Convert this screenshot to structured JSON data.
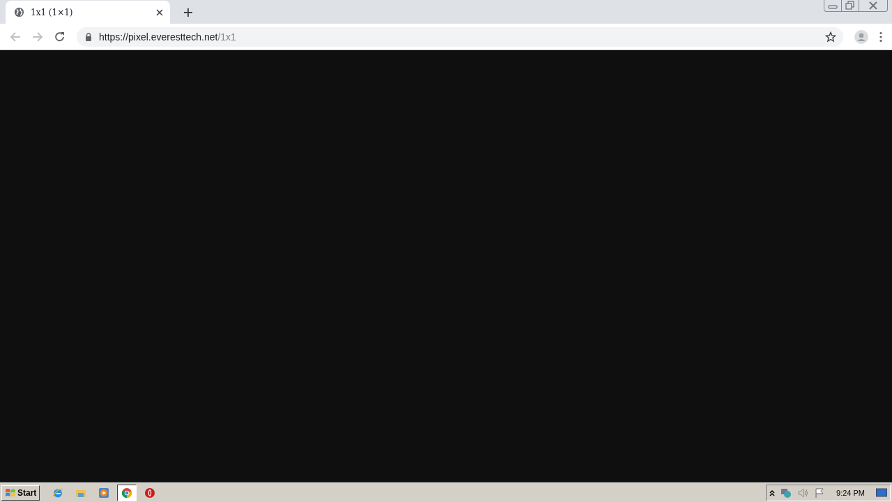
{
  "tabs": [
    {
      "title": "1x1 (1×1)",
      "selected": true
    }
  ],
  "address_bar": {
    "scheme_host": "https://pixel.everesttech.net",
    "path": "/1x1"
  },
  "toolbar": {
    "back_disabled": true,
    "forward_disabled": true
  },
  "taskbar": {
    "start_label": "Start",
    "apps": [
      {
        "kind": "ie",
        "selected": false
      },
      {
        "kind": "explorer",
        "selected": false
      },
      {
        "kind": "media",
        "selected": false
      },
      {
        "kind": "chrome",
        "selected": true
      },
      {
        "kind": "opera",
        "selected": false
      }
    ],
    "clock": "9:24 PM"
  }
}
